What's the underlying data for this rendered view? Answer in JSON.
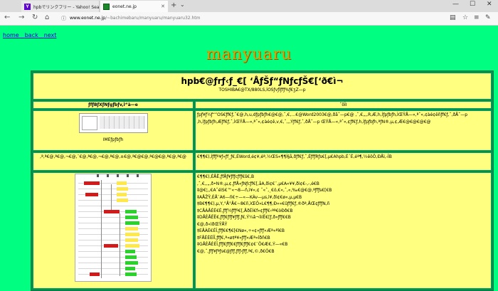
{
  "browser": {
    "tabs": [
      {
        "title": "hpbでリンクフリー - Yahoo! Sea"
      },
      {
        "title": "eonet.ne.jp"
      }
    ],
    "url": {
      "domain": "www.eonet.ne.jp",
      "path": "/~bachimebaru/manyuaru/manyuaru32.htm"
    }
  },
  "page": {
    "nav": {
      "home": "home",
      "sep1": "　",
      "back": "back",
      "sep2": "　",
      "next": "next"
    },
    "logo": "manyuaru",
    "title": "hpb€@ƒrƒ‹ƒ_€[ ‘ÅƒŠƒ“ƒNƒcƒŠ€[‘ð€ì¬",
    "subtitle": "TOSHIBA€@TX/880LS,İOSƒvƒİƒfƒ%ƒ€ʒZ—p",
    "col_left_header": "ƒfƒBƒXƒNƒgƒbƒv,Ì“à—e",
    "col_right_header": "ˆõÎI",
    "row1_caption": "IMEƒpƒbƒh",
    "row1_text": "ƒpƒ¥ƒ½ƒ“”OS€ƒf€ƒ,ˆ€@,h,u,dƒpƒbƒh€@€@,ˆ,€,…€@Word2003€@,ðãˆ—p€@ ,ˆ,€„,,R,Æ,h,İƒpƒbƒh,ÌŒŸÅ—«,ªˆ«,¢àé¢êñƒf€ƒ,ˆ,ðÅ˜—p ,h,İƒpƒbƒh,Æƒf€ƒ,ˆ,ÌŒŸÅ—«,ªˆ«,¢àé¢ê,v,€,ˆ,,,Ýƒf€ƒ,ˆ,ðÅ˜—p ŒŸÅ—«,ªˆ«,¢ƒf€ƒ,h,İƒpƒbƒh,ªƒN®,µ,¢,Æ€@€@€@€@",
    "row2_left": ",ª,ª€@,ª€@,¬€@,¨€@,ª€@,¬€@,ª€@,±€@,ª€@€@,ª€@€@,ª€@,ª€@",
    "row2_right": "€¶¶€),İƒfƒº¥ƒ«ƒf_ƒ€,ÉWord,é¢¥,éª,½ŒS«¶¶Í§å,ðƒf€ƒ,ˆ,ÉƒfƒRƒs€[,μ€Ahpb,É´É,éª¶,½êôÖ,ÐÅì,-ÎB",
    "row3_lines": [
      "€¶¶€),ÉÅË,ƒfÅƒ¥ƒfƒcƒfƒ€š€,B",
      ",ˆ,€,,„,ð•N®,µ,¢,ƒfÅ«ƒNƒcƒf€[,åA,ðì¢€¨,µ€A«¥¥,ðì¢€-,-,é€B",
      "‡@€¦,,€AˆéìS€™«¬8—ñ,ì¥«,¢ ˆ«ˆ,¸€ö,€«,ˆ,«,‰€@€@,ªƒfƒs€[€B",
      "‡AÅŽŸ,ÉÅ¨A6—ñ€÷—«—KÀv—µs,ì¥,ðì¢€ø«,µ,µ€B",
      "‡B€¶¶€),μ,Y,°Å°Å€~8€ñ,ìŒÖ»L€¶¶,Ð««€ûƒfƒ€ƒ,®ðª,ÅŒ¢ƒfƒN,ñ",
      "‡CÅÀÅÈÈ€È,ƒfƒ½ƒfƒº€[,ÅðÉİ€f«¢ƒfƒ€‹ªª€òÐð€B",
      "‡DÅÈÅËË€,ƒfƒ€ƒfƒ¥ƒfƒ,ƒ€,Ý¼â¬ììíË€[ƒ,ð«ƒfƒ€€B",
      "€@,ð«ìðŒŸÅŸ",
      "‡EÅÀÈ€ÈÎ,ƒfƒ€€¶€[€Nø«,÷«¢«ƒfƒ«Æª«ªî€B",
      "‡FÅÈÈÈÎÎ,ƒfƒ€,ª«ø‡ª¥«ƒfƒ«Æª«îðñ€B",
      "‡GÅÈÅÈÈÎ,ƒfƒ€ƒfƒ€€ƒfƒ€ƒfƒ€¢€¨Ö€Æ€,Ý—«€B",
      "€@,ˆ,ƒfƒ¥ƒªƒs€@ƒfƒ,ƒfƒ‹ƒfƒ,ª€,©,ð€Ò€B"
    ]
  }
}
